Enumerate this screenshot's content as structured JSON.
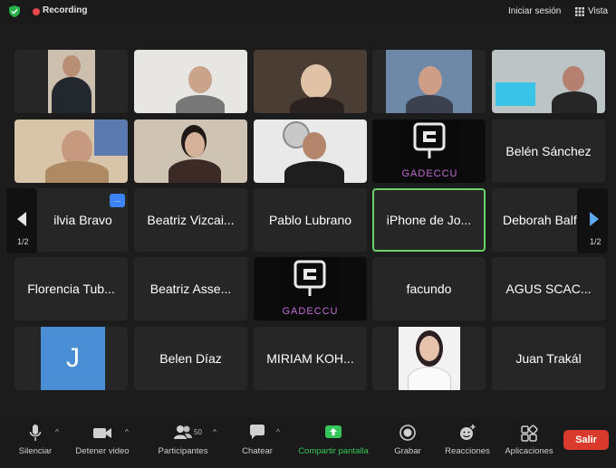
{
  "topbar": {
    "recording_label": "Recording",
    "signin_label": "Iniciar sesión",
    "view_label": "Vista"
  },
  "gallery": {
    "page_indicator_left": "1/2",
    "page_indicator_right": "1/2",
    "more_button": "...",
    "tiles": [
      {
        "type": "video",
        "name": ""
      },
      {
        "type": "video",
        "name": ""
      },
      {
        "type": "video",
        "name": ""
      },
      {
        "type": "video",
        "name": ""
      },
      {
        "type": "video",
        "name": ""
      },
      {
        "type": "video",
        "name": ""
      },
      {
        "type": "video",
        "name": ""
      },
      {
        "type": "video",
        "name": ""
      },
      {
        "type": "logo",
        "name": "GADECCU"
      },
      {
        "type": "name",
        "name": "Belén Sánchez"
      },
      {
        "type": "name",
        "name": "ilvia Bravo"
      },
      {
        "type": "name",
        "name": "Beatriz Vizcai..."
      },
      {
        "type": "name",
        "name": "Pablo Lubrano"
      },
      {
        "type": "name",
        "name": "iPhone de Jo...",
        "active": true
      },
      {
        "type": "name",
        "name": "Deborah Balf..."
      },
      {
        "type": "name",
        "name": "Florencia Tub..."
      },
      {
        "type": "name",
        "name": "Beatriz Asse..."
      },
      {
        "type": "logo",
        "name": "GADECCU"
      },
      {
        "type": "name",
        "name": "facundo"
      },
      {
        "type": "name",
        "name": "AGUS SCAC..."
      },
      {
        "type": "avatar",
        "name": "J"
      },
      {
        "type": "name",
        "name": "Belen Díaz"
      },
      {
        "type": "name",
        "name": "MIRIAM KOH..."
      },
      {
        "type": "photo",
        "name": ""
      },
      {
        "type": "name",
        "name": "Juan Trakál"
      }
    ]
  },
  "toolbar": {
    "mute": "Silenciar",
    "stop_video": "Detener video",
    "participants": "Participantes",
    "participants_count": "50",
    "chat": "Chatear",
    "share": "Compartir pantalla",
    "record": "Grabar",
    "reactions": "Reacciones",
    "apps": "Aplicaciones",
    "leave": "Salir"
  },
  "colors": {
    "accent_green": "#35c759",
    "leave_red": "#d93a2b",
    "avatar_blue": "#4a8fd6",
    "logo_purple": "#c46bd6"
  }
}
